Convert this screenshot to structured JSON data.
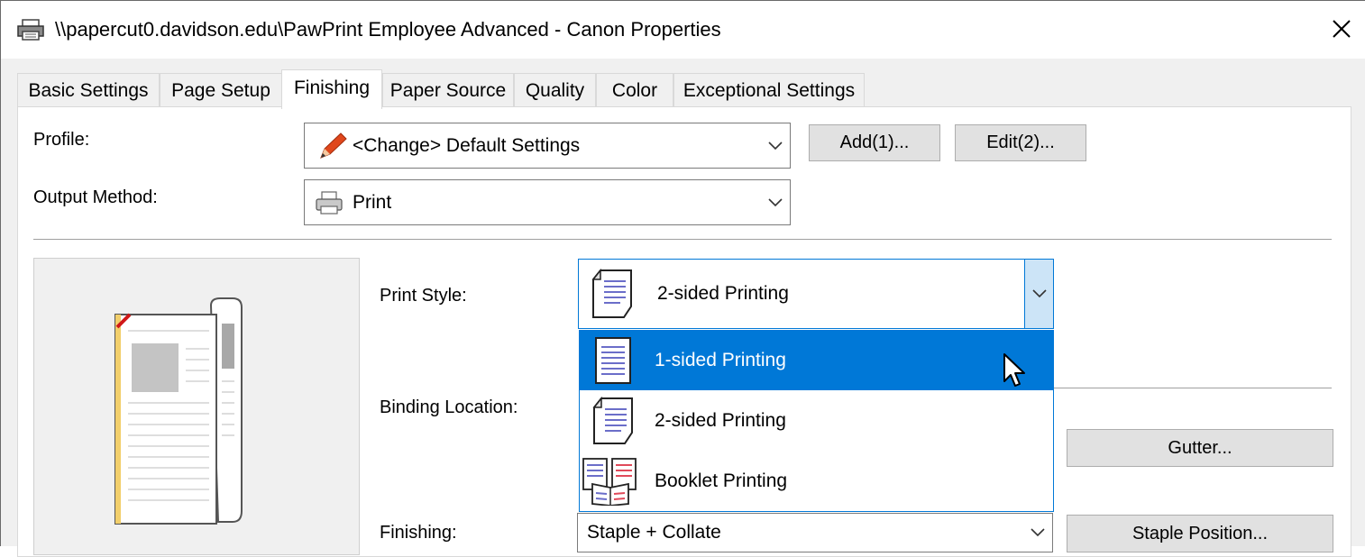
{
  "window": {
    "title": "\\\\papercut0.davidson.edu\\PawPrint Employee Advanced - Canon Properties",
    "icons": {
      "app": "printer-icon",
      "close": "close-icon"
    }
  },
  "tabs": [
    {
      "label": "Basic Settings"
    },
    {
      "label": "Page Setup"
    },
    {
      "label": "Finishing",
      "active": true
    },
    {
      "label": "Paper Source"
    },
    {
      "label": "Quality"
    },
    {
      "label": "Color"
    },
    {
      "label": "Exceptional Settings"
    }
  ],
  "profile": {
    "label": "Profile:",
    "value": "<Change> Default Settings",
    "icon": "pencil-icon",
    "add_label": "Add(1)...",
    "edit_label": "Edit(2)..."
  },
  "output_method": {
    "label": "Output Method:",
    "value": "Print",
    "icon": "printer-icon"
  },
  "print_style": {
    "label": "Print Style:",
    "value": "2-sided Printing",
    "options": [
      {
        "label": "1-sided Printing",
        "icon": "one-sided-page-icon",
        "hovered": true
      },
      {
        "label": "2-sided Printing",
        "icon": "two-sided-page-icon"
      },
      {
        "label": "Booklet Printing",
        "icon": "booklet-icon"
      }
    ]
  },
  "binding_location": {
    "label": "Binding Location:",
    "gutter_label": "Gutter..."
  },
  "finishing": {
    "label": "Finishing:",
    "value": "Staple + Collate",
    "staple_position_label": "Staple Position..."
  },
  "colors": {
    "accent": "#0078d7",
    "panel": "#ffffff",
    "dialog_bg": "#f0f0f0"
  }
}
